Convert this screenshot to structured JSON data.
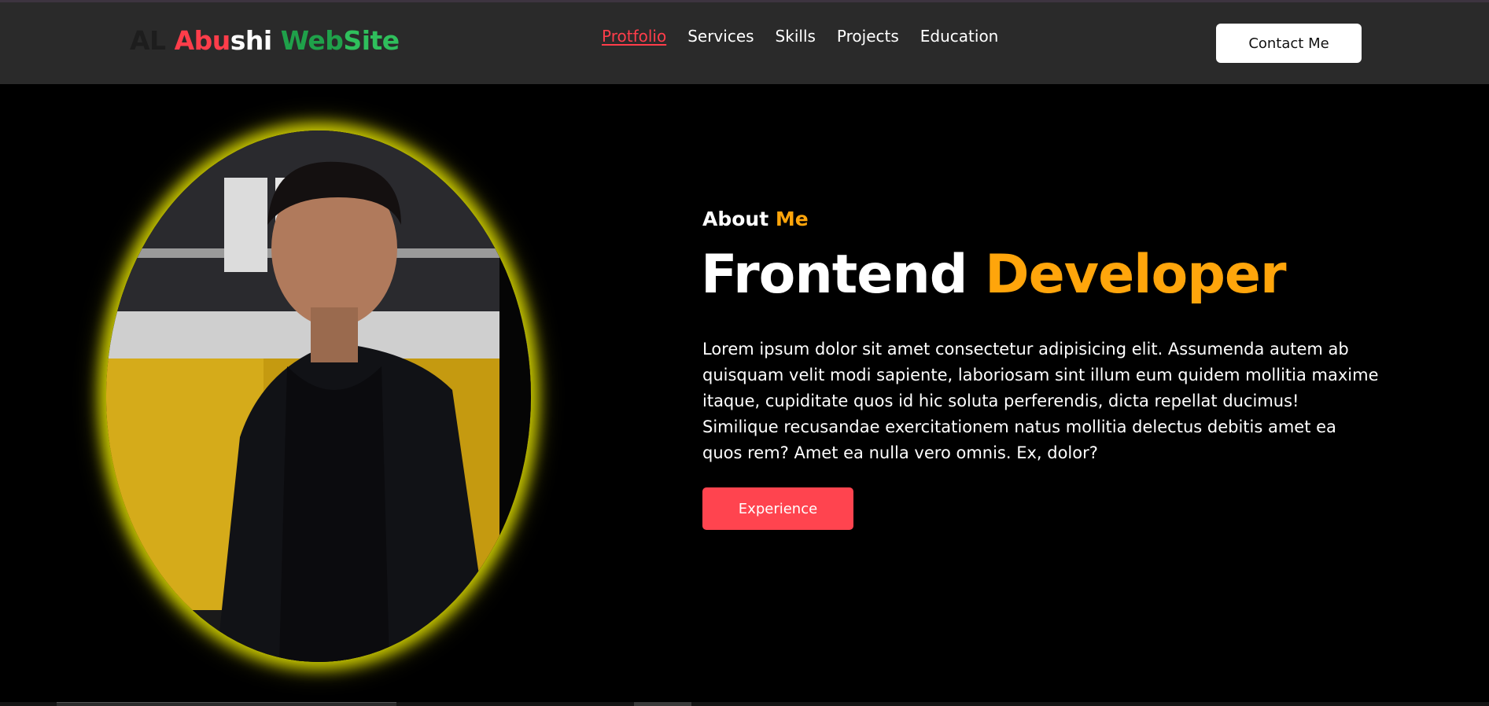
{
  "logo": {
    "part1": "AL",
    "part2": "Abu",
    "part3": "shi",
    "part4": "Web",
    "part5": "Site"
  },
  "nav": {
    "items": [
      {
        "label": "Protfolio",
        "active": true
      },
      {
        "label": "Services",
        "active": false
      },
      {
        "label": "Skills",
        "active": false
      },
      {
        "label": "Projects",
        "active": false
      },
      {
        "label": "Education",
        "active": false
      }
    ]
  },
  "header": {
    "contact_label": "Contact Me"
  },
  "hero": {
    "about_label": "About",
    "about_accent": "Me",
    "title": "Frontend",
    "title_accent": "Developer",
    "bio": "Lorem ipsum dolor sit amet consectetur adipisicing elit. Assumenda autem ab quisquam velit modi sapiente, laboriosam sint illum eum quidem mollitia maxime itaque, cupiditate quos id hic soluta perferendis, dicta repellat ducimus! Similique recusandae exercitationem natus mollitia delectus debitis amet ea quos rem? Amet ea nulla vero omnis. Ex, dolor?",
    "button_label": "Experience",
    "portrait_icon": "profile-photo"
  },
  "colors": {
    "accent_red": "#ff3d4a",
    "accent_orange": "#ffa50b",
    "accent_green": "#1fa14a",
    "glow": "#c9c800",
    "header_bg": "#2a2a2a"
  }
}
